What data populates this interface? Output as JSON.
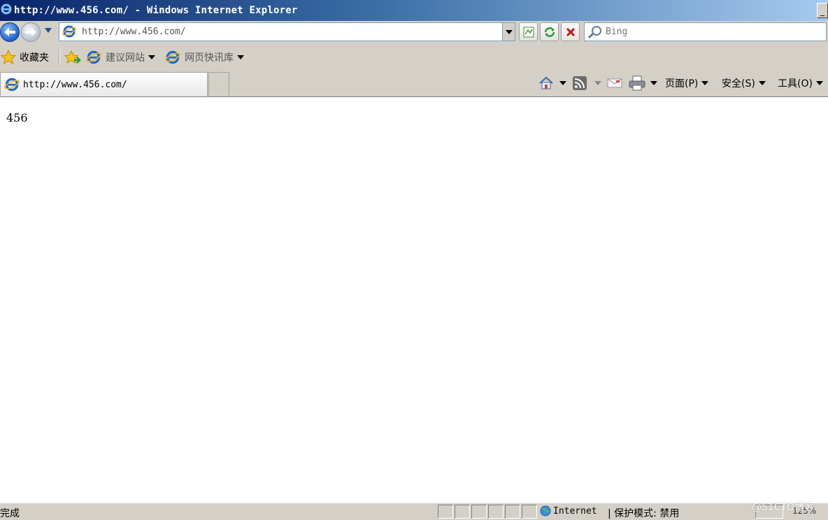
{
  "window": {
    "title": "http://www.456.com/ - Windows Internet Explorer",
    "minimize_glyph": "_"
  },
  "address_bar": {
    "url": "http://www.456.com/"
  },
  "search": {
    "placeholder": "Bing"
  },
  "favorites_bar": {
    "favorites_label": "收藏夹",
    "items": [
      {
        "label": "建议网站",
        "icon": "ie-icon"
      },
      {
        "label": "网页快讯库",
        "icon": "ie-icon"
      }
    ]
  },
  "tabs": [
    {
      "label": "http://www.456.com/"
    }
  ],
  "command_bar": {
    "page_label": "页面(P)",
    "safety_label": "安全(S)",
    "tools_label": "工具(O)"
  },
  "page": {
    "text": "456"
  },
  "status_bar": {
    "status": "完成",
    "zone": "Internet",
    "protected_mode": "保护模式: 禁用",
    "zoom": "125%"
  },
  "watermark": "@51CTO博客",
  "colors": {
    "titlebar_start": "#0a246a",
    "titlebar_end": "#a6caf0",
    "chrome": "#d4d0c8",
    "stop_red": "#d01010"
  }
}
